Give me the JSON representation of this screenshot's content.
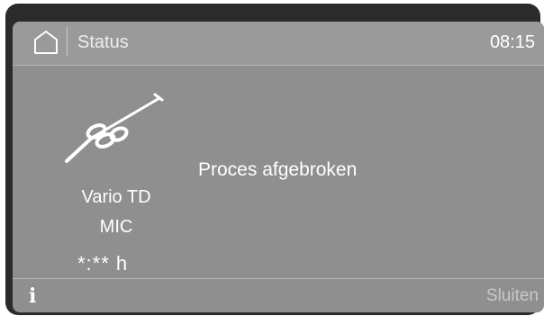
{
  "header": {
    "title": "Status",
    "time": "08:15",
    "home_icon": "home-icon"
  },
  "program": {
    "icon": "endoscope-instrument-icon",
    "name_line1": "Vario TD",
    "name_line2": "MIC",
    "time_remaining": "*:** h"
  },
  "message": "Proces afgebroken",
  "footer": {
    "info_icon": "info-icon",
    "info_label": "i",
    "close_label": "Sluiten"
  },
  "colors": {
    "screen_bg": "#8f8f8f",
    "bezel": "#2b2b2b",
    "text": "#ffffff",
    "disabled_text": "#c8c8c8"
  }
}
